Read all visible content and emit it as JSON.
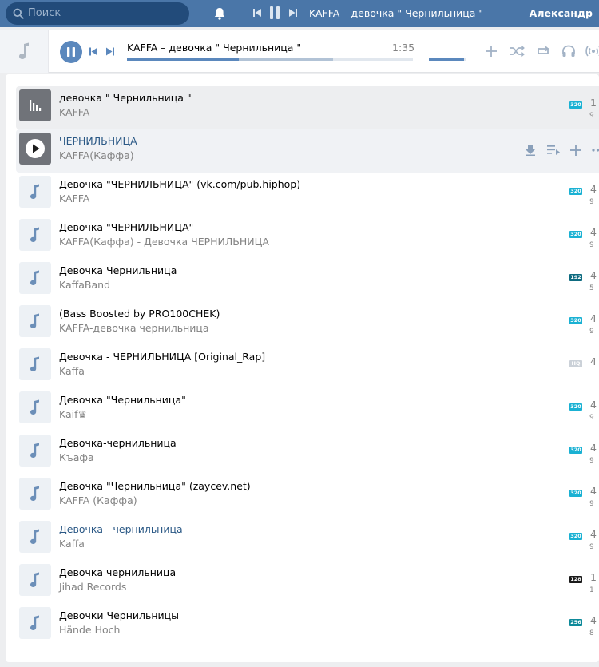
{
  "colors": {
    "header": "#4a76a8",
    "accent": "#5b88bd",
    "link": "#2a5885",
    "muted": "#828282",
    "badge_teal": "#1ab1d3",
    "badge_dark_teal": "#0e6b80",
    "badge_black": "#1a1a1a",
    "badge_hq": "#cbd1d8"
  },
  "topbar": {
    "search_placeholder": "Поиск",
    "now_playing": "KAFFA – девочка \" Чернильница \"",
    "user_name": "Александр"
  },
  "player": {
    "title": "KAFFA – девочка \" Чернильница \"",
    "time": "1:35",
    "progress": 0.39,
    "buffered": 0.72,
    "volume": 0.95
  },
  "tracks": [
    {
      "title": "девочка \" Чернильница \"",
      "artist": "KAFFA",
      "badge": "320",
      "badge_color": "#1ab1d3",
      "duration": "1",
      "sub": "9",
      "state": "current",
      "title_link": false
    },
    {
      "title": "ЧЕРНИЛЬНИЦА",
      "artist": "KAFFA(Каффа)",
      "badge": "",
      "badge_color": "",
      "duration": "",
      "sub": "",
      "state": "hover",
      "title_link": true
    },
    {
      "title": "Девочка \"ЧЕРНИЛЬНИЦА\" (vk.com/pub.hiphop)",
      "artist": "KAFFA",
      "badge": "320",
      "badge_color": "#1ab1d3",
      "duration": "4",
      "sub": "9",
      "state": "normal",
      "title_link": false
    },
    {
      "title": "Девочка \"ЧЕРНИЛЬНИЦА\"",
      "artist": "KAFFA(Каффа) - Девочка ЧЕРНИЛЬНИЦА",
      "badge": "320",
      "badge_color": "#1ab1d3",
      "duration": "4",
      "sub": "9",
      "state": "normal",
      "title_link": false
    },
    {
      "title": "Девочка Чернильница",
      "artist": "KaffaBand",
      "badge": "192",
      "badge_color": "#0e6b80",
      "duration": "4",
      "sub": "5",
      "state": "normal",
      "title_link": false
    },
    {
      "title": "(Bass Boosted by PRO100CHEK)",
      "artist": "KAFFA-девочка чернильница",
      "badge": "320",
      "badge_color": "#1ab1d3",
      "duration": "4",
      "sub": "9",
      "state": "normal",
      "title_link": false
    },
    {
      "title": "Девочка - ЧЕРНИЛЬНИЦА [Original_Rap]",
      "artist": "Kaffa",
      "badge": "HQ",
      "badge_color": "#cbd1d8",
      "duration": "4",
      "sub": "",
      "state": "normal",
      "title_link": false
    },
    {
      "title": "Девочка \"Чернильница\"",
      "artist": "Kaif♛",
      "badge": "320",
      "badge_color": "#1ab1d3",
      "duration": "4",
      "sub": "9",
      "state": "normal",
      "title_link": false
    },
    {
      "title": "Девочка-чернильница",
      "artist": "Къафа",
      "badge": "320",
      "badge_color": "#1ab1d3",
      "duration": "4",
      "sub": "9",
      "state": "normal",
      "title_link": false
    },
    {
      "title": "Девочка \"Чернильница\" (zaycev.net)",
      "artist": "KAFFA (Каффа)",
      "badge": "320",
      "badge_color": "#1ab1d3",
      "duration": "4",
      "sub": "9",
      "state": "normal",
      "title_link": false
    },
    {
      "title": "Девочка - чернильница",
      "artist": "Kaffa",
      "badge": "320",
      "badge_color": "#1ab1d3",
      "duration": "4",
      "sub": "9",
      "state": "normal",
      "title_link": true
    },
    {
      "title": "Девочка чернильница",
      "artist": "Jihad Records",
      "badge": "128",
      "badge_color": "#1a1a1a",
      "duration": "1",
      "sub": "1",
      "state": "normal",
      "title_link": false
    },
    {
      "title": "Девочки Чернильницы",
      "artist": "Hände Hoch",
      "badge": "256",
      "badge_color": "#0e8a9a",
      "duration": "4",
      "sub": "8",
      "state": "normal",
      "title_link": false
    }
  ]
}
